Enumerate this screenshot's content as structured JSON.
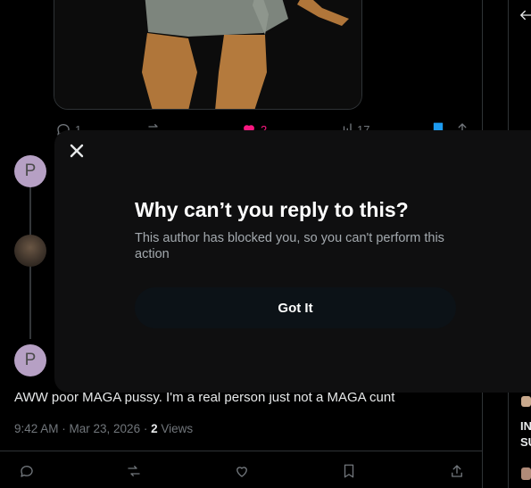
{
  "modal": {
    "close_icon": "close-icon",
    "title": "Why can’t you reply to this?",
    "body": "This author has blocked you, so you can't perform this action",
    "button_label": "Got It"
  },
  "top_post": {
    "reply_count": "1",
    "like_count": "2",
    "view_count": "17",
    "icons": [
      "reply-icon",
      "retweet-icon",
      "like-icon",
      "views-icon",
      "bookmark-icon",
      "share-icon"
    ]
  },
  "replies": [
    {
      "avatar_letter": "P"
    },
    {
      "avatar_letter": ""
    },
    {
      "avatar_letter": "P"
    }
  ],
  "main_post": {
    "text": "AWW poor MAGA pussy. I'm a real person just not a MAGA cunt",
    "time": "9:42 AM · Mar 23, 2026 · ",
    "views_count": "2",
    "views_label": " Views",
    "icons": [
      "reply-icon",
      "retweet-icon",
      "like-icon",
      "bookmark-icon",
      "share-icon"
    ]
  },
  "right_column": {
    "line1": "IN",
    "line2": "SU"
  },
  "colors": {
    "background": "#000000",
    "modal_background": "#0f0f10",
    "like_active": "#f91880",
    "bookmark_active": "#1d9bf0",
    "muted_text": "#71767b"
  }
}
